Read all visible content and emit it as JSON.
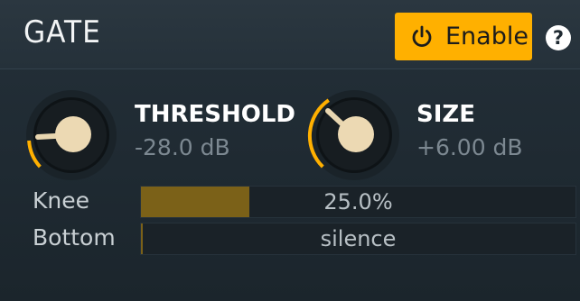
{
  "header": {
    "title": "GATE",
    "enable_label": "Enable",
    "help_label": "?",
    "enable_color": "#ffb000"
  },
  "threshold": {
    "name": "THRESHOLD",
    "value": "-28.0 dB"
  },
  "size": {
    "name": "SIZE",
    "value": "+6.00 dB"
  },
  "knee": {
    "label": "Knee",
    "value": "25.0%",
    "level": 0.25
  },
  "bottom": {
    "label": "Bottom",
    "value": "silence",
    "level": 0.0
  }
}
